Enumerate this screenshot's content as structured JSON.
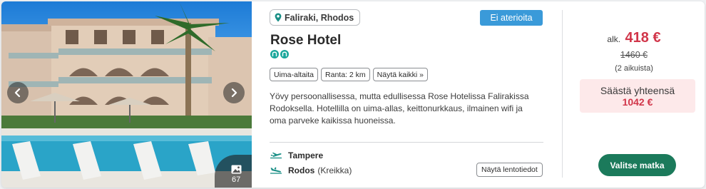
{
  "gallery": {
    "photo_count": "67"
  },
  "location": {
    "text": "Faliraki, Rhodos",
    "icon": "map-pin-icon"
  },
  "meal": {
    "label": "Ei aterioita",
    "color": "#3a9ad9"
  },
  "hotel": {
    "name": "Rose Hotel",
    "rating_icons": 2
  },
  "tags": [
    {
      "label": "Uima-altaita"
    },
    {
      "label": "Ranta: 2 km"
    },
    {
      "label": "Näytä kaikki »"
    }
  ],
  "description": "Yövy persoonallisessa, mutta edullisessa Rose Hotelissa Falirakissa Rodoksella. Hotellilla on uima-allas, keittonurkkaus, ilmainen wifi ja oma parveke kaikissa huoneissa.",
  "flights": {
    "outbound": {
      "city": "Tampere",
      "icon": "plane-departure-icon"
    },
    "return": {
      "city": "Rodos",
      "country": "(Kreikka)",
      "icon": "plane-arrival-icon"
    },
    "details_button": "Näytä lentotiedot"
  },
  "price": {
    "from_label": "alk.",
    "value": "418 €",
    "original": "1460 €",
    "note": "(2 aikuista)",
    "savings_label": "Säästä yhteensä",
    "savings_amount": "1042 €",
    "accent_color": "#d1364a"
  },
  "cta": {
    "label": "Valitse matka",
    "color": "#1b7a5b"
  }
}
